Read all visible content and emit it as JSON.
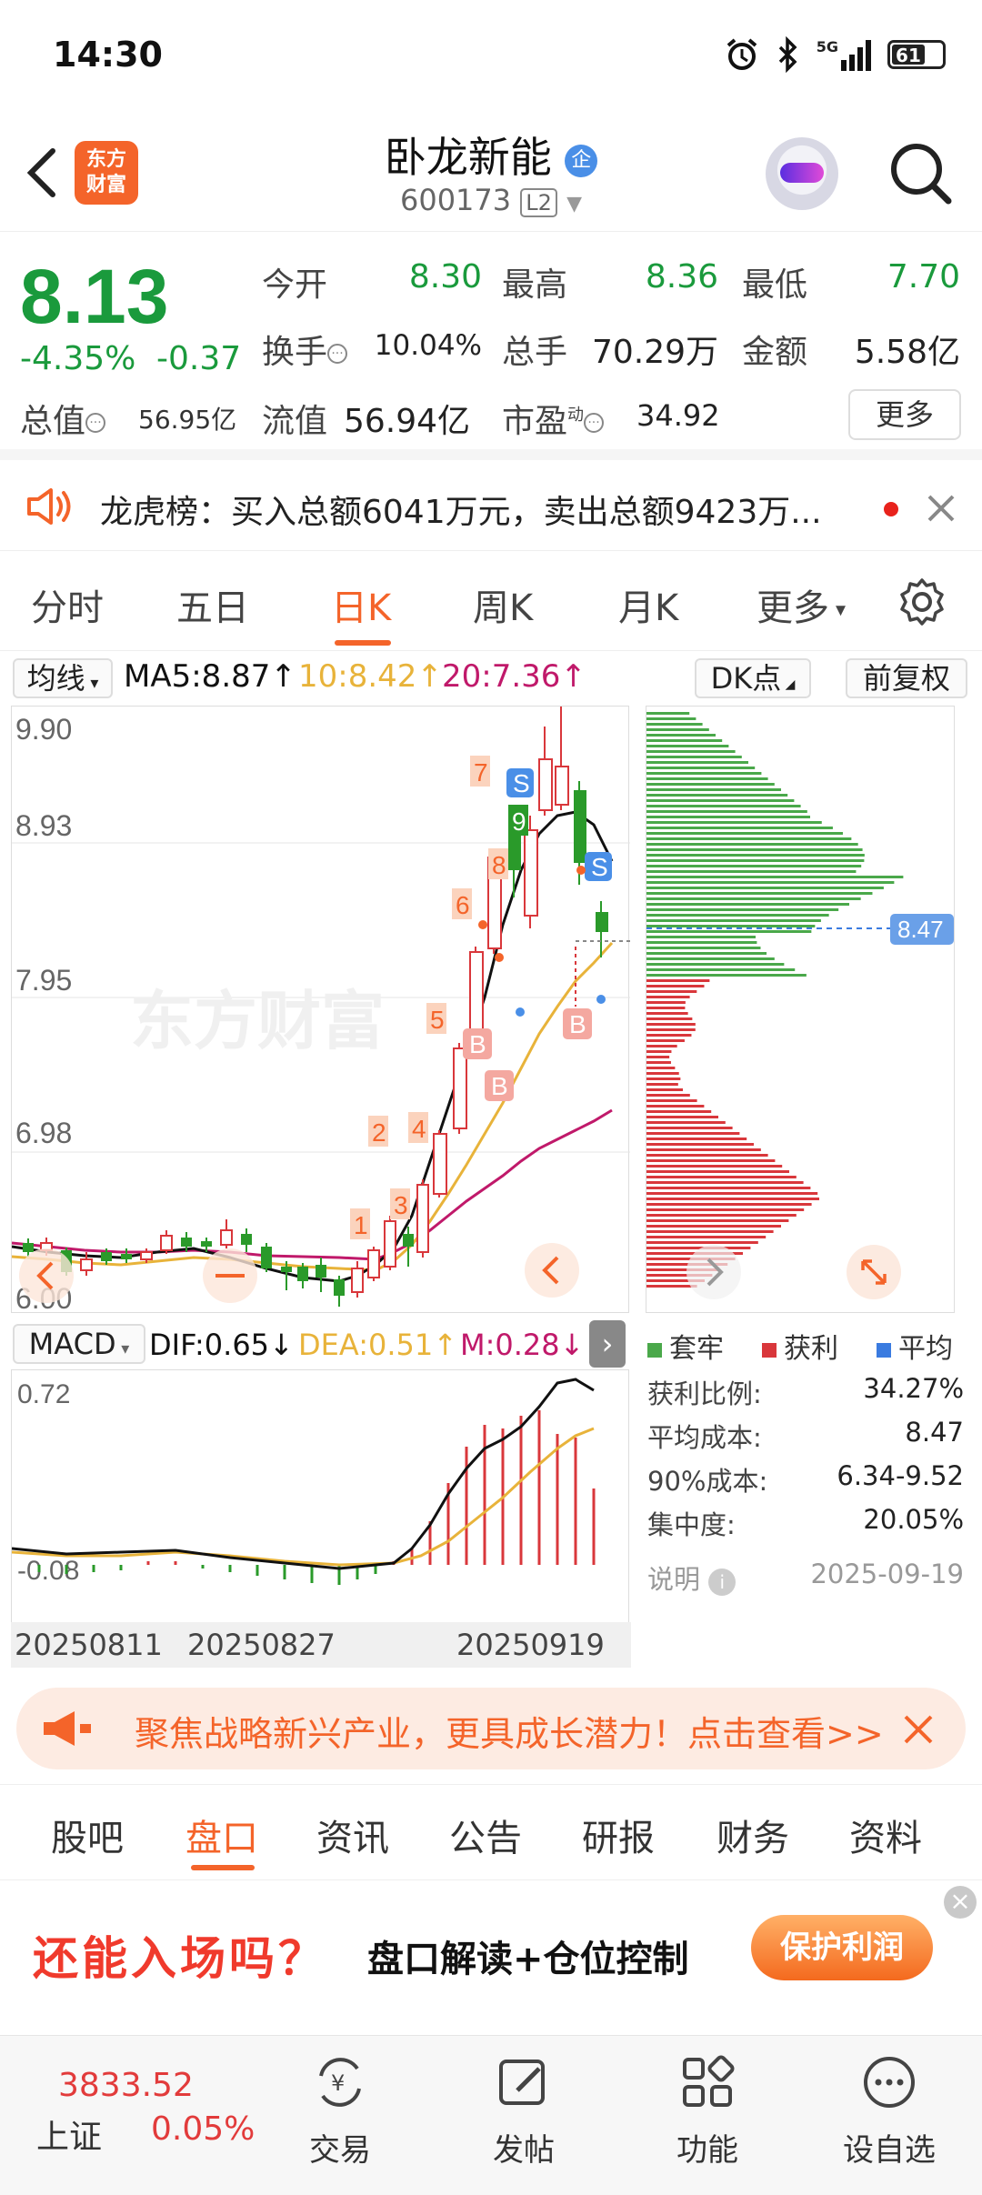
{
  "status_bar": {
    "time": "14:30",
    "battery": "61",
    "network": "5G"
  },
  "header": {
    "logo_line1": "东方",
    "logo_line2": "财富",
    "stock_name": "卧龙新能",
    "badge": "企",
    "stock_code": "600173",
    "level": "L2"
  },
  "quote": {
    "price": "8.13",
    "change_pct": "-4.35%",
    "change": "-0.37",
    "open_label": "今开",
    "open": "8.30",
    "high_label": "最高",
    "high": "8.36",
    "low_label": "最低",
    "low": "7.70",
    "turnover_label": "换手",
    "turnover": "10.04%",
    "volume_label": "总手",
    "volume": "70.29万",
    "amount_label": "金额",
    "amount": "5.58亿",
    "mktcap_label": "总值",
    "mktcap": "56.95亿",
    "float_label": "流值",
    "float": "56.94亿",
    "pe_label": "市盈",
    "pe_sup": "动",
    "pe": "34.92",
    "more": "更多"
  },
  "dragon_tiger": {
    "text": "龙虎榜：买入总额6041万元，卖出总额9423万..."
  },
  "chart_tabs": [
    "分时",
    "五日",
    "日K",
    "周K",
    "月K",
    "更多"
  ],
  "ma": {
    "selector": "均线",
    "ma5": "MA5:8.87↑",
    "ma10": "10:8.42↑",
    "ma20": "20:7.36↑",
    "dk": "DK点",
    "adjust": "前复权",
    "colors": {
      "ma5": "#111111",
      "ma10": "#e8b33a",
      "ma20": "#c0196a"
    }
  },
  "kline_axis": [
    "9.90",
    "8.93",
    "7.95",
    "6.98",
    "6.00"
  ],
  "kline_markers": [
    "1",
    "2",
    "3",
    "4",
    "5",
    "6",
    "7",
    "8",
    "9",
    "S",
    "S",
    "B",
    "B",
    "B"
  ],
  "chip": {
    "cost_label": "8.47",
    "legend": [
      "套牢",
      "获利",
      "平均"
    ],
    "legend_colors": [
      "#4aa84a",
      "#d9373b",
      "#3a7be0"
    ],
    "stats": [
      {
        "k": "获利比例:",
        "v": "34.27%"
      },
      {
        "k": "平均成本:",
        "v": "8.47"
      },
      {
        "k": "90%成本:",
        "v": "6.34-9.52"
      },
      {
        "k": "集中度:",
        "v": "20.05%"
      }
    ],
    "note": "说明",
    "date": "2025-09-19"
  },
  "macd": {
    "selector": "MACD",
    "dif": "DIF:0.65↓",
    "dea": "DEA:0.51↑",
    "m": "M:0.28↓",
    "top": "0.72",
    "bottom": "-0.08",
    "dates": [
      "20250811",
      "20250827",
      "20250919"
    ]
  },
  "promo": {
    "text": "聚焦战略新兴产业，更具成长潜力！点击查看>>"
  },
  "bottom_tabs": [
    "股吧",
    "盘口",
    "资讯",
    "公告",
    "研报",
    "财务",
    "资料"
  ],
  "ad": {
    "title": "还能入场吗？",
    "subtitle": "盘口解读+仓位控制",
    "button": "保护利润"
  },
  "bottom_bar": {
    "index_value": "3833.52",
    "index_name": "上证",
    "index_pct": "0.05%",
    "trade": "交易",
    "post": "发帖",
    "func": "功能",
    "watch": "设自选"
  }
}
